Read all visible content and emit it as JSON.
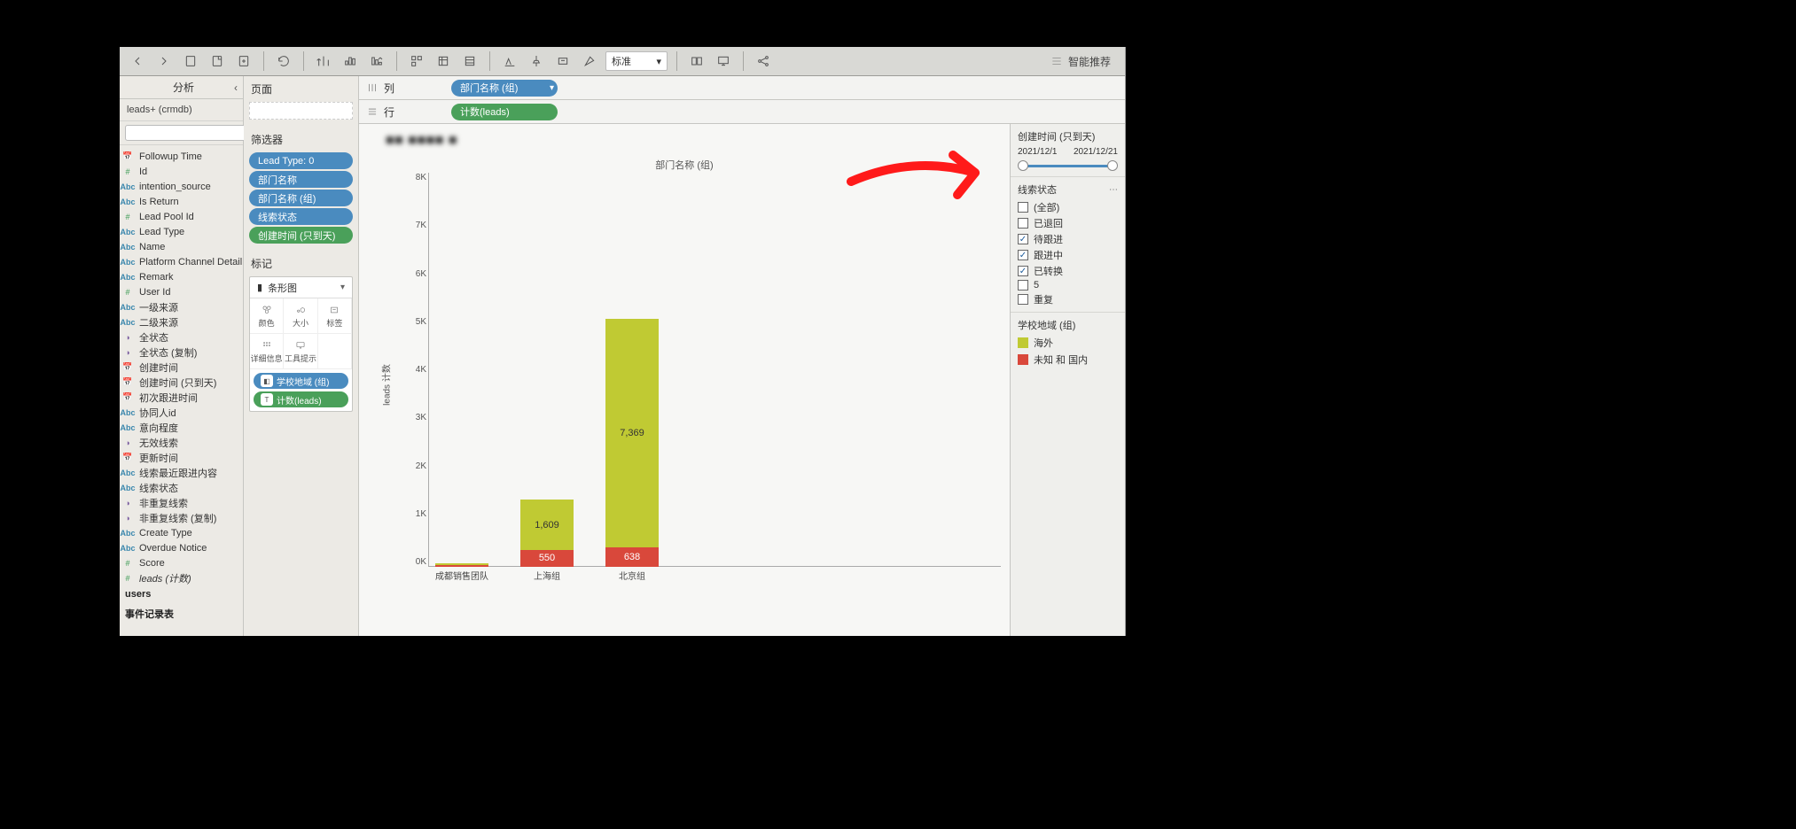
{
  "toolbar": {
    "fit_mode": "标准",
    "smart_recommend": "智能推荐"
  },
  "analysis_label": "分析",
  "datasource": "leads+ (crmdb)",
  "fields": [
    {
      "name": "Followup Time",
      "icon": "date"
    },
    {
      "name": "Id",
      "icon": "num"
    },
    {
      "name": "intention_source",
      "icon": "abc"
    },
    {
      "name": "Is Return",
      "icon": "abc"
    },
    {
      "name": "Lead Pool Id",
      "icon": "num"
    },
    {
      "name": "Lead Type",
      "icon": "abc"
    },
    {
      "name": "Name",
      "icon": "abc"
    },
    {
      "name": "Platform Channel Detail",
      "icon": "abc"
    },
    {
      "name": "Remark",
      "icon": "abc"
    },
    {
      "name": "User Id",
      "icon": "num"
    },
    {
      "name": "一级来源",
      "icon": "abc"
    },
    {
      "name": "二级来源",
      "icon": "abc"
    },
    {
      "name": "全状态",
      "icon": "set"
    },
    {
      "name": "全状态 (复制)",
      "icon": "set"
    },
    {
      "name": "创建时间",
      "icon": "date"
    },
    {
      "name": "创建时间 (只到天)",
      "icon": "date"
    },
    {
      "name": "初次跟进时间",
      "icon": "date"
    },
    {
      "name": "协同人id",
      "icon": "abc"
    },
    {
      "name": "意向程度",
      "icon": "abc"
    },
    {
      "name": "无效线索",
      "icon": "set"
    },
    {
      "name": "更新时间",
      "icon": "date"
    },
    {
      "name": "线索最近跟进内容",
      "icon": "abc"
    },
    {
      "name": "线索状态",
      "icon": "abc"
    },
    {
      "name": "非重复线索",
      "icon": "set"
    },
    {
      "name": "非重复线索 (复制)",
      "icon": "set"
    },
    {
      "name": "Create Type",
      "icon": "abc"
    },
    {
      "name": "Overdue Notice",
      "icon": "abc"
    },
    {
      "name": "Score",
      "icon": "num"
    },
    {
      "name": "leads (计数)",
      "icon": "num",
      "italic": true
    }
  ],
  "section_users": "users",
  "section_events": "事件记录表",
  "middle": {
    "pages_label": "页面",
    "filters_label": "筛选器",
    "marks_label": "标记",
    "marks_type": "条形图",
    "mark_cells": [
      "颜色",
      "大小",
      "标签",
      "详细信息",
      "工具提示"
    ],
    "color_pill": "学校地域 (组)",
    "label_pill": "计数(leads)"
  },
  "filters": [
    {
      "label": "Lead Type: 0",
      "cls": "blue"
    },
    {
      "label": "部门名称",
      "cls": "blue"
    },
    {
      "label": "部门名称 (组)",
      "cls": "blue"
    },
    {
      "label": "线索状态",
      "cls": "blue"
    },
    {
      "label": "创建时间 (只到天)",
      "cls": "green"
    }
  ],
  "shelves": {
    "columns_label": "列",
    "rows_label": "行",
    "columns_pills": [
      {
        "label": "部门名称 (组)",
        "cls": "blue",
        "drop": true
      }
    ],
    "rows_pills": [
      {
        "label": "计数(leads)",
        "cls": "green"
      }
    ]
  },
  "right": {
    "date_title": "创建时间 (只到天)",
    "date_from": "2021/12/1",
    "date_to": "2021/12/21",
    "status_title": "线索状态",
    "status_items": [
      {
        "label": "(全部)",
        "checked": false
      },
      {
        "label": "已退回",
        "checked": false
      },
      {
        "label": "待跟进",
        "checked": true
      },
      {
        "label": "跟进中",
        "checked": true
      },
      {
        "label": "已转换",
        "checked": true
      },
      {
        "label": "5",
        "checked": false
      },
      {
        "label": "重复",
        "checked": false
      }
    ],
    "legend_title": "学校地域 (组)",
    "legend": [
      {
        "label": "海外",
        "color": "green"
      },
      {
        "label": "未知 和 国内",
        "color": "red"
      }
    ]
  },
  "chart_data": {
    "type": "bar",
    "stacked": true,
    "title": "",
    "sub_title": "部门名称 (组)",
    "categories": [
      "成都销售团队",
      "上海组",
      "北京组"
    ],
    "series": [
      {
        "name": "未知 和 国内",
        "color": "#d9483b",
        "values": [
          60,
          550,
          638
        ]
      },
      {
        "name": "海外",
        "color": "#c0ca33",
        "values": [
          40,
          1609,
          7369
        ]
      }
    ],
    "labels_visible": [
      [
        "",
        ""
      ],
      [
        "550",
        "1,609"
      ],
      [
        "638",
        "7,369"
      ]
    ],
    "ylabel": "leads 计数",
    "ylim": [
      0,
      8000
    ],
    "yticks": [
      "0K",
      "1K",
      "2K",
      "3K",
      "4K",
      "5K",
      "6K",
      "7K",
      "8K"
    ]
  }
}
